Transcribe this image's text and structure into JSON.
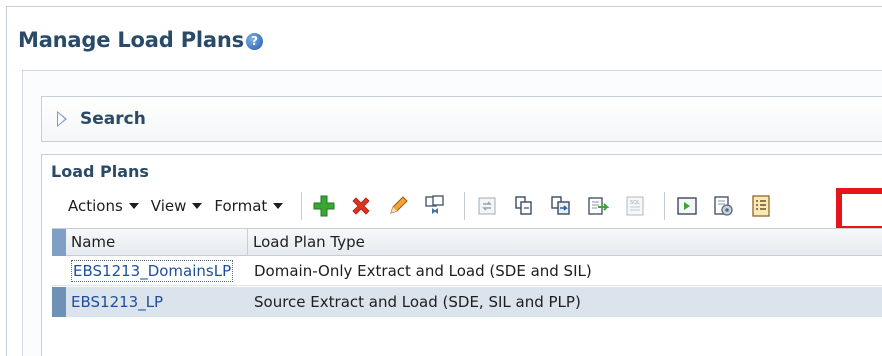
{
  "page": {
    "title": "Manage Load Plans"
  },
  "search": {
    "label": "Search"
  },
  "load_plans": {
    "header": "Load Plans",
    "menus": [
      "Actions",
      "View",
      "Format"
    ],
    "toolbar_icons": [
      "add-icon",
      "delete-icon",
      "edit-icon",
      "duplicate-icon",
      "refresh-icon",
      "copy-icon",
      "move-icon",
      "export-icon",
      "sql-icon",
      "execute-icon",
      "schedule-icon",
      "details-icon"
    ],
    "columns": {
      "name": "Name",
      "type": "Load Plan Type"
    },
    "rows": [
      {
        "name": "EBS1213_DomainsLP",
        "type": "Domain-Only Extract and Load (SDE and SIL)"
      },
      {
        "name": "EBS1213_LP",
        "type": "Source Extract and Load (SDE, SIL and PLP)"
      }
    ]
  },
  "colors": {
    "title": "#2a4a67",
    "highlight": "#e8141b",
    "selected_row": "#dbe3ec",
    "link": "#1f4f9a"
  }
}
